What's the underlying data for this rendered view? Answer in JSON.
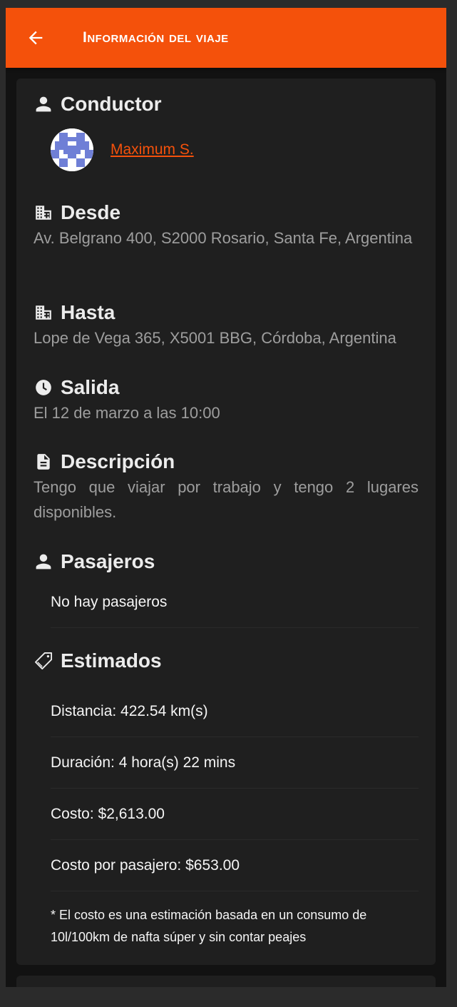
{
  "appbar": {
    "title": "Información del viaje",
    "back_icon": "arrow-left-icon"
  },
  "driver": {
    "heading": "Conductor",
    "name": "Maximum S."
  },
  "from": {
    "heading": "Desde",
    "address": "Av. Belgrano 400, S2000 Rosario, Santa Fe, Argentina"
  },
  "to": {
    "heading": "Hasta",
    "address": "Lope de Vega 365, X5001 BBG, Córdoba, Argentina"
  },
  "departure": {
    "heading": "Salida",
    "text": "El 12 de marzo a las 10:00"
  },
  "description": {
    "heading": "Descripción",
    "text": "Tengo que viajar por trabajo y tengo 2 lugares disponibles."
  },
  "passengers": {
    "heading": "Pasajeros",
    "empty": "No hay pasajeros"
  },
  "estimates": {
    "heading": "Estimados",
    "distance": "Distancia: 422.54 km(s)",
    "duration": "Duración: 4 hora(s) 22 mins",
    "cost": "Costo: $2,613.00",
    "cost_per_passenger": "Costo por pasajero: $653.00",
    "note": "* El costo es una estimación basada en un consumo de 10l/100km de nafta súper y sin contar peajes"
  },
  "colors": {
    "accent": "#f4510b",
    "card": "#1f1f1f",
    "background": "#121212"
  }
}
